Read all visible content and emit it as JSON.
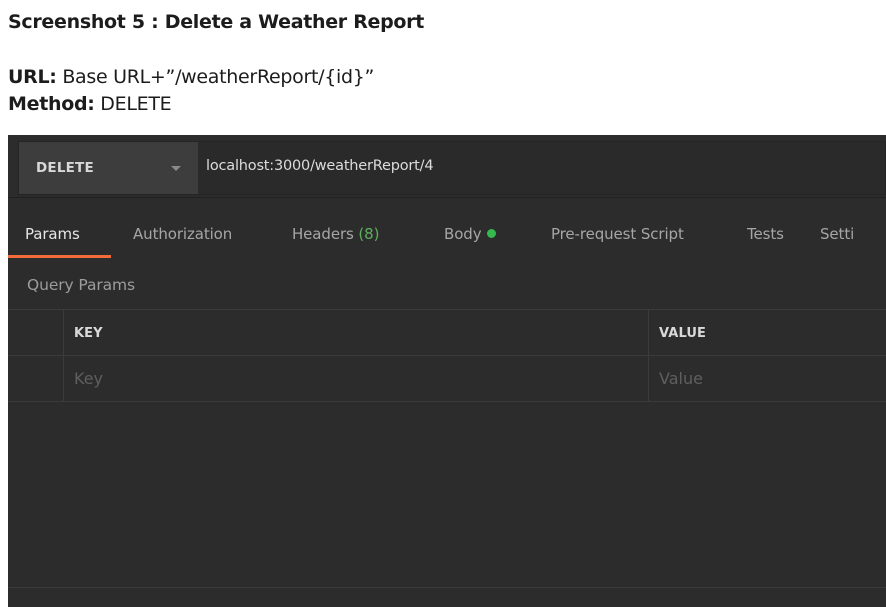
{
  "doc": {
    "title": "Screenshot 5 : Delete a Weather Report",
    "url_label": "URL:",
    "url_value": " Base URL+”/weatherReport/{id}”",
    "method_label": "Method:",
    "method_value": " DELETE"
  },
  "request": {
    "method": "DELETE",
    "url": "localhost:3000/weatherReport/4"
  },
  "tabs": [
    {
      "label": "Params",
      "active": true
    },
    {
      "label": "Authorization"
    },
    {
      "label": "Headers",
      "count": "(8)"
    },
    {
      "label": "Body"
    },
    {
      "label": "Pre-request Script"
    },
    {
      "label": "Tests"
    },
    {
      "label": "Setti"
    }
  ],
  "query_params": {
    "title": "Query Params",
    "columns": [
      "KEY",
      "VALUE"
    ],
    "placeholder_key": "Key",
    "placeholder_value": "Value"
  },
  "colors": {
    "active_tab_underline": "#f26b3a",
    "status_dot": "#35b84d",
    "header_count": "#5bb05b",
    "background": "#2c2c2c"
  }
}
